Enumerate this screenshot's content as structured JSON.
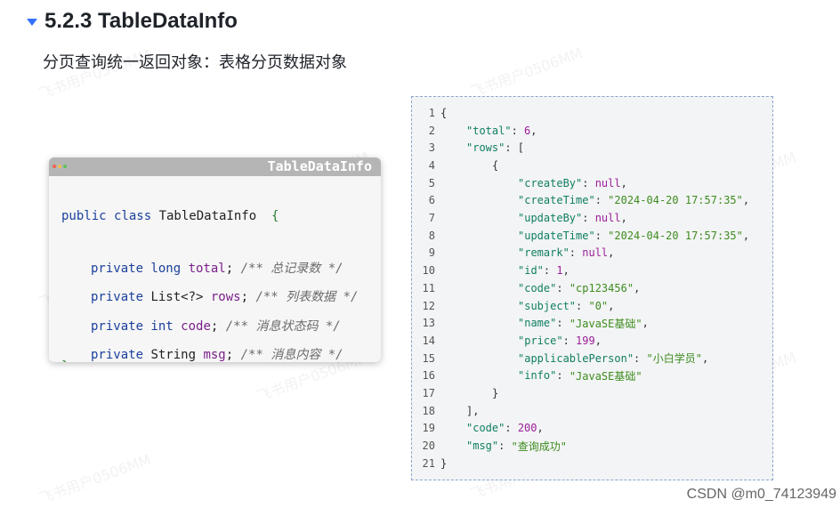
{
  "heading": {
    "title": "5.2.3 TableDataInfo"
  },
  "description": "分页查询统一返回对象：表格分页数据对象",
  "code_card": {
    "title": "TableDataInfo",
    "lines": [
      {
        "parts": [
          [
            "kw",
            "public class "
          ],
          [
            "pl",
            "TableDataInfo  "
          ],
          [
            "br",
            "{"
          ]
        ]
      },
      {
        "parts": [
          [
            "kw",
            "private long "
          ],
          [
            "fld",
            "total"
          ],
          [
            "pl",
            "; "
          ],
          [
            "cm",
            "/** 总记录数 */"
          ]
        ]
      },
      {
        "parts": [
          [
            "kw",
            "private "
          ],
          [
            "pl",
            "List<?> "
          ],
          [
            "fld",
            "rows"
          ],
          [
            "pl",
            "; "
          ],
          [
            "cm",
            "/** 列表数据 */"
          ]
        ]
      },
      {
        "parts": [
          [
            "kw",
            "private int "
          ],
          [
            "fld",
            "code"
          ],
          [
            "pl",
            "; "
          ],
          [
            "cm",
            "/** 消息状态码 */"
          ]
        ]
      },
      {
        "parts": [
          [
            "kw",
            "private "
          ],
          [
            "pl",
            "String "
          ],
          [
            "fld",
            "msg"
          ],
          [
            "pl",
            "; "
          ],
          [
            "cm",
            "/** 消息内容 */"
          ]
        ]
      },
      {
        "parts": [
          [
            "br",
            "}"
          ]
        ]
      }
    ]
  },
  "json_lines": [
    {
      "n": "1",
      "indent": 0,
      "tokens": [
        [
          "jp",
          "{"
        ]
      ]
    },
    {
      "n": "2",
      "indent": 1,
      "tokens": [
        [
          "jk",
          "\"total\""
        ],
        [
          "jp",
          ": "
        ],
        [
          "jn",
          "6"
        ],
        [
          "jp",
          ","
        ]
      ]
    },
    {
      "n": "3",
      "indent": 1,
      "tokens": [
        [
          "jk",
          "\"rows\""
        ],
        [
          "jp",
          ": ["
        ]
      ]
    },
    {
      "n": "4",
      "indent": 2,
      "tokens": [
        [
          "jp",
          "{"
        ]
      ]
    },
    {
      "n": "5",
      "indent": 3,
      "tokens": [
        [
          "jk",
          "\"createBy\""
        ],
        [
          "jp",
          ": "
        ],
        [
          "jn",
          "null"
        ],
        [
          "jp",
          ","
        ]
      ]
    },
    {
      "n": "6",
      "indent": 3,
      "tokens": [
        [
          "jk",
          "\"createTime\""
        ],
        [
          "jp",
          ": "
        ],
        [
          "js",
          "\"2024-04-20 17:57:35\""
        ],
        [
          "jp",
          ","
        ]
      ]
    },
    {
      "n": "7",
      "indent": 3,
      "tokens": [
        [
          "jk",
          "\"updateBy\""
        ],
        [
          "jp",
          ": "
        ],
        [
          "jn",
          "null"
        ],
        [
          "jp",
          ","
        ]
      ]
    },
    {
      "n": "8",
      "indent": 3,
      "tokens": [
        [
          "jk",
          "\"updateTime\""
        ],
        [
          "jp",
          ": "
        ],
        [
          "js",
          "\"2024-04-20 17:57:35\""
        ],
        [
          "jp",
          ","
        ]
      ]
    },
    {
      "n": "9",
      "indent": 3,
      "tokens": [
        [
          "jk",
          "\"remark\""
        ],
        [
          "jp",
          ": "
        ],
        [
          "jn",
          "null"
        ],
        [
          "jp",
          ","
        ]
      ]
    },
    {
      "n": "10",
      "indent": 3,
      "tokens": [
        [
          "jk",
          "\"id\""
        ],
        [
          "jp",
          ": "
        ],
        [
          "jn",
          "1"
        ],
        [
          "jp",
          ","
        ]
      ]
    },
    {
      "n": "11",
      "indent": 3,
      "tokens": [
        [
          "jk",
          "\"code\""
        ],
        [
          "jp",
          ": "
        ],
        [
          "js",
          "\"cp123456\""
        ],
        [
          "jp",
          ","
        ]
      ]
    },
    {
      "n": "12",
      "indent": 3,
      "tokens": [
        [
          "jk",
          "\"subject\""
        ],
        [
          "jp",
          ": "
        ],
        [
          "js",
          "\"0\""
        ],
        [
          "jp",
          ","
        ]
      ]
    },
    {
      "n": "13",
      "indent": 3,
      "tokens": [
        [
          "jk",
          "\"name\""
        ],
        [
          "jp",
          ": "
        ],
        [
          "js",
          "\"JavaSE基础\""
        ],
        [
          "jp",
          ","
        ]
      ]
    },
    {
      "n": "14",
      "indent": 3,
      "tokens": [
        [
          "jk",
          "\"price\""
        ],
        [
          "jp",
          ": "
        ],
        [
          "jn",
          "199"
        ],
        [
          "jp",
          ","
        ]
      ]
    },
    {
      "n": "15",
      "indent": 3,
      "tokens": [
        [
          "jk",
          "\"applicablePerson\""
        ],
        [
          "jp",
          ": "
        ],
        [
          "js",
          "\"小白学员\""
        ],
        [
          "jp",
          ","
        ]
      ]
    },
    {
      "n": "16",
      "indent": 3,
      "tokens": [
        [
          "jk",
          "\"info\""
        ],
        [
          "jp",
          ": "
        ],
        [
          "js",
          "\"JavaSE基础\""
        ]
      ]
    },
    {
      "n": "17",
      "indent": 2,
      "tokens": [
        [
          "jp",
          "}"
        ]
      ]
    },
    {
      "n": "18",
      "indent": 1,
      "tokens": [
        [
          "jp",
          "],"
        ]
      ]
    },
    {
      "n": "19",
      "indent": 1,
      "tokens": [
        [
          "jk",
          "\"code\""
        ],
        [
          "jp",
          ": "
        ],
        [
          "jn",
          "200"
        ],
        [
          "jp",
          ","
        ]
      ]
    },
    {
      "n": "20",
      "indent": 1,
      "tokens": [
        [
          "jk",
          "\"msg\""
        ],
        [
          "jp",
          ": "
        ],
        [
          "js",
          "\"查询成功\""
        ]
      ]
    },
    {
      "n": "21",
      "indent": 0,
      "tokens": [
        [
          "jp",
          "}"
        ]
      ]
    }
  ],
  "watermark_text": "飞书用户0506MM",
  "footer": "CSDN @m0_74123949"
}
